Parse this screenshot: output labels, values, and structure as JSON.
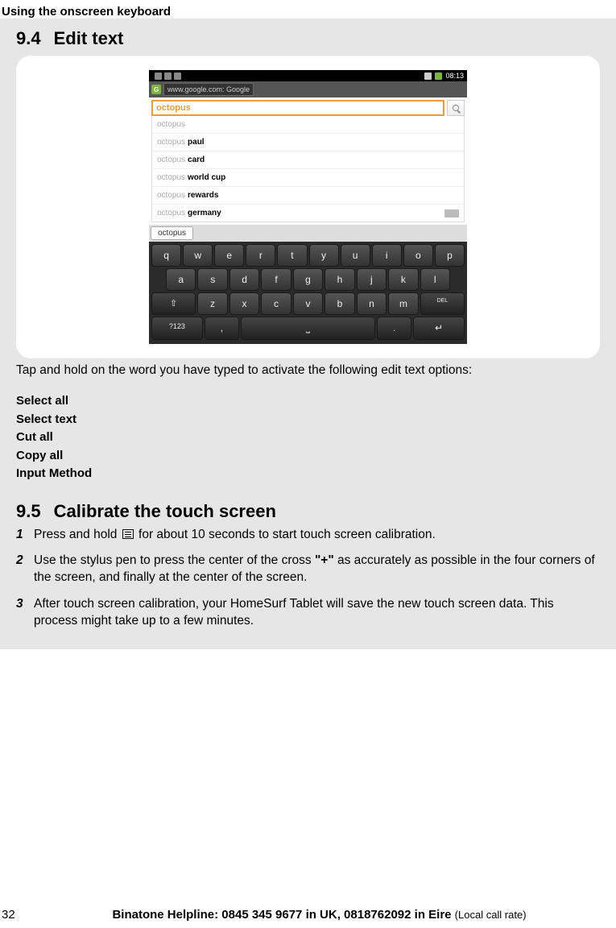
{
  "header": {
    "title": "Using the onscreen keyboard"
  },
  "section94": {
    "number": "9.4",
    "title": "Edit text",
    "caption": "Tap and hold on the word you have typed to activate the following edit text options:",
    "options": [
      "Select all",
      "Select text",
      "Cut all",
      "Copy all",
      "Input Method"
    ]
  },
  "screenshot": {
    "time": "08:13",
    "url": "www.google.com: Google",
    "search_value": "octopus",
    "suggestions": [
      {
        "prefix": "octopus",
        "bold": ""
      },
      {
        "prefix": "octopus",
        "bold": "paul"
      },
      {
        "prefix": "octopus",
        "bold": "card"
      },
      {
        "prefix": "octopus",
        "bold": "world cup"
      },
      {
        "prefix": "octopus",
        "bold": "rewards"
      },
      {
        "prefix": "octopus",
        "bold": "germany"
      }
    ],
    "kb_suggestion": "octopus",
    "rows": {
      "r1": [
        "q",
        "w",
        "e",
        "r",
        "t",
        "y",
        "u",
        "i",
        "o",
        "p"
      ],
      "r2": [
        "a",
        "s",
        "d",
        "f",
        "g",
        "h",
        "j",
        "k",
        "l"
      ],
      "r3": [
        "⇧",
        "z",
        "x",
        "c",
        "v",
        "b",
        "n",
        "m",
        "⌫"
      ],
      "r4": [
        "?123",
        ",",
        "␣",
        ".",
        "↵"
      ]
    },
    "del_label": "DEL"
  },
  "section95": {
    "number": "9.5",
    "title": "Calibrate the touch screen",
    "steps": [
      {
        "num": "1",
        "text_a": "Press and hold ",
        "text_b": " for about 10 seconds to start touch screen calibration.",
        "has_icon": true
      },
      {
        "num": "2",
        "text_a": "Use the stylus pen to press the center of the cross ",
        "plus": "\"+\"",
        "text_b": " as accurately as possible in the four corners of the screen, and finally at the center of the screen."
      },
      {
        "num": "3",
        "text_a": "After touch screen calibration, your HomeSurf Tablet will save the new touch screen data. This process might take up to a few minutes."
      }
    ]
  },
  "footer": {
    "page": "32",
    "text": "Binatone Helpline: 0845 345 9677 in UK, 0818762092 in Eire ",
    "rate": "(Local call rate)"
  }
}
